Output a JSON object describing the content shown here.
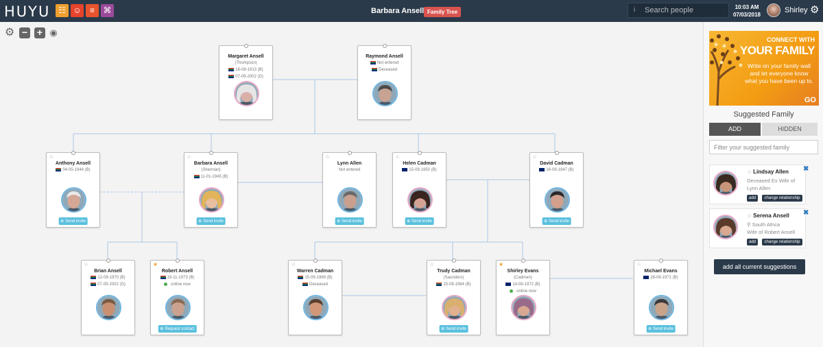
{
  "header": {
    "logo": "HUYU",
    "apps": [
      {
        "icon": "tree-icon",
        "color": "#f0a030",
        "glyph": "☷"
      },
      {
        "icon": "person-icon",
        "color": "#e8432d",
        "glyph": "☺"
      },
      {
        "icon": "notes-icon",
        "color": "#e8542d",
        "glyph": "≡"
      },
      {
        "icon": "gift-icon",
        "color": "#9b4a9b",
        "glyph": "⌘"
      }
    ],
    "title_name": "Barbara Ansell",
    "title_sep": " - ",
    "badge": "Family Tree",
    "search_placeholder": "Search people",
    "info_glyph": "i",
    "time": "10:03 AM",
    "date": "07/03/2018",
    "username": "Shirley",
    "gear_glyph": "⚙"
  },
  "toolbar": {
    "settings_glyph": "⚙",
    "zoom_out_glyph": "−",
    "zoom_in_glyph": "+",
    "locate_glyph": "◉"
  },
  "cards": [
    {
      "id": "margaret",
      "name": "Margaret Ansell",
      "sub": "(Thompson)",
      "l1": "16-08-1913 (B)",
      "l2": "07-09-2002 (D)",
      "f1": "za",
      "f2": "za",
      "gender": "f",
      "skin": "#d9b0a8",
      "hair": "#e5e5e5",
      "star": false,
      "action": ""
    },
    {
      "id": "raymond",
      "name": "Raymond Ansell",
      "sub": "",
      "l1": "Not entered",
      "l2": "Deceased",
      "f1": "za",
      "f2": "za",
      "gender": "m",
      "skin": "#c8a292",
      "hair": "#4a4a4a",
      "star": false,
      "action": ""
    },
    {
      "id": "anthony",
      "name": "Anthony Ansell",
      "sub": "",
      "l1": "04-05-1944 (B)",
      "l2": "",
      "f1": "za",
      "f2": "",
      "gender": "m",
      "skin": "#d6a794",
      "hair": "#e8e8e8",
      "star": true,
      "action": "Send invite"
    },
    {
      "id": "barbara",
      "name": "Barbara Ansell",
      "sub": "(Sherman)",
      "l1": "11-01-1945 (B)",
      "l2": "",
      "f1": "za",
      "f2": "",
      "gender": "f",
      "skin": "#e9bfa0",
      "hair": "#e1b45a",
      "star": true,
      "action": "Send invite"
    },
    {
      "id": "lynn",
      "name": "Lynn Allen",
      "sub": "",
      "l1": "Not entered",
      "l2": "",
      "f1": "",
      "f2": "",
      "gender": "m",
      "skin": "#c9a08d",
      "hair": "#6a6a6a",
      "star": true,
      "action": "Send invite"
    },
    {
      "id": "helen",
      "name": "Helen Cadman",
      "sub": "",
      "l1": "15-09-1950 (B)",
      "l2": "",
      "f1": "au",
      "f2": "",
      "gender": "f",
      "skin": "#d4a393",
      "hair": "#3a2520",
      "star": true,
      "action": "Send invite"
    },
    {
      "id": "david",
      "name": "David Cadman",
      "sub": "",
      "l1": "16-09-1947 (B)",
      "l2": "",
      "f1": "au",
      "f2": "",
      "gender": "m",
      "skin": "#d2a08c",
      "hair": "#2a2a2a",
      "star": true,
      "action": "Send invite"
    },
    {
      "id": "brian",
      "name": "Brian Ansell",
      "sub": "",
      "l1": "12-08-1970 (B)",
      "l2": "07-09-2002 (D)",
      "f1": "za",
      "f2": "za",
      "gender": "m",
      "skin": "#c89070",
      "hair": "#7a5a40",
      "star": true,
      "action": ""
    },
    {
      "id": "robert",
      "name": "Robert Ansell",
      "sub": "",
      "l1": "19-11-1973 (B)",
      "l2": "online now",
      "f1": "za",
      "f2": "online",
      "gender": "m",
      "skin": "#caa28e",
      "hair": "#8a6a55",
      "star": "fav",
      "action": "Request contact"
    },
    {
      "id": "warren",
      "name": "Warren Cadman",
      "sub": "",
      "l1": "15-09-1969 (B)",
      "l2": "Deceased",
      "f1": "za",
      "f2": "za",
      "gender": "m",
      "skin": "#d09878",
      "hair": "#5a4030",
      "star": true,
      "action": ""
    },
    {
      "id": "trudy",
      "name": "Trudy Cadman",
      "sub": "(Saunders)",
      "l1": "15-08-1964 (B)",
      "l2": "",
      "f1": "za",
      "f2": "",
      "gender": "f",
      "skin": "#e0b08f",
      "hair": "#d9b070",
      "star": true,
      "action": "Send invite"
    },
    {
      "id": "shirley",
      "name": "Shirley Evans",
      "sub": "(Cadman)",
      "l1": "14-08-1972 (B)",
      "l2": "online now",
      "f1": "au",
      "f2": "online",
      "gender": "f",
      "skin": "#d8a890",
      "hair": "#9a6a8a",
      "star": "fav",
      "action": ""
    },
    {
      "id": "michael",
      "name": "Michael Evans",
      "sub": "",
      "l1": "28-08-1971 (B)",
      "l2": "",
      "f1": "uk",
      "f2": "",
      "gender": "m",
      "skin": "#c9a28a",
      "hair": "#3a3a3a",
      "star": true,
      "action": "Send invite"
    }
  ],
  "sidebar": {
    "ad": {
      "line1": "CONNECT WITH",
      "line2": "YOUR FAMILY",
      "body": "Write on your family wall and let everyone know what you have been up to.",
      "go": "GO"
    },
    "title": "Suggested Family",
    "tab_add": "ADD",
    "tab_hidden": "HIDDEN",
    "filter_placeholder": "Filter your suggested family",
    "suggestions": [
      {
        "name": "Lindsay Allen",
        "desc": "Deceased Ex Wife of Lynn Allen",
        "add": "add",
        "change": "change relationship",
        "skin": "#c9957a",
        "hair": "#3a2a20"
      },
      {
        "name": "Serena Ansell",
        "desc": "⚲ South Africa\nWife of Robert Ansell",
        "add": "add",
        "change": "change relationship",
        "skin": "#d8a890",
        "hair": "#5a3a2a"
      }
    ],
    "close_glyph": "✖",
    "add_all": "add all current suggestions"
  }
}
